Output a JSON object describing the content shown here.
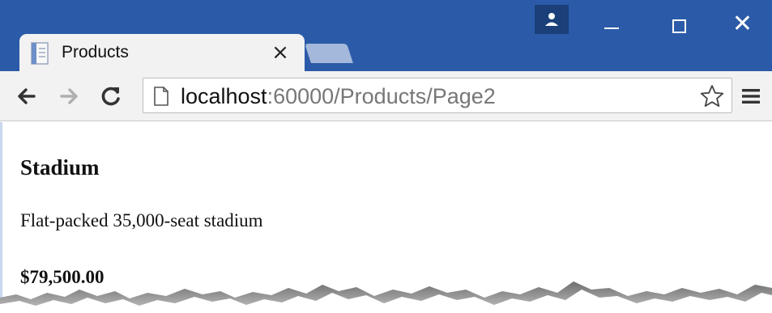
{
  "tab": {
    "title": "Products",
    "close_glyph": "×"
  },
  "window_controls": {
    "close_glyph": "✕"
  },
  "toolbar": {
    "url_host": "localhost",
    "url_path": ":60000/Products/Page2"
  },
  "product": {
    "name": "Stadium",
    "description": "Flat-packed 35,000-seat stadium",
    "price": "$79,500.00"
  },
  "colors": {
    "titlebar": "#2b5ba8",
    "toolbar": "#f2f2f2",
    "accent": "#1a3f79"
  },
  "icons": [
    "page-favicon-icon",
    "close-icon",
    "profile-icon",
    "minimize-icon",
    "maximize-icon",
    "window-close-icon",
    "back-arrow-icon",
    "forward-arrow-icon",
    "reload-icon",
    "page-icon",
    "star-icon",
    "menu-icon"
  ]
}
